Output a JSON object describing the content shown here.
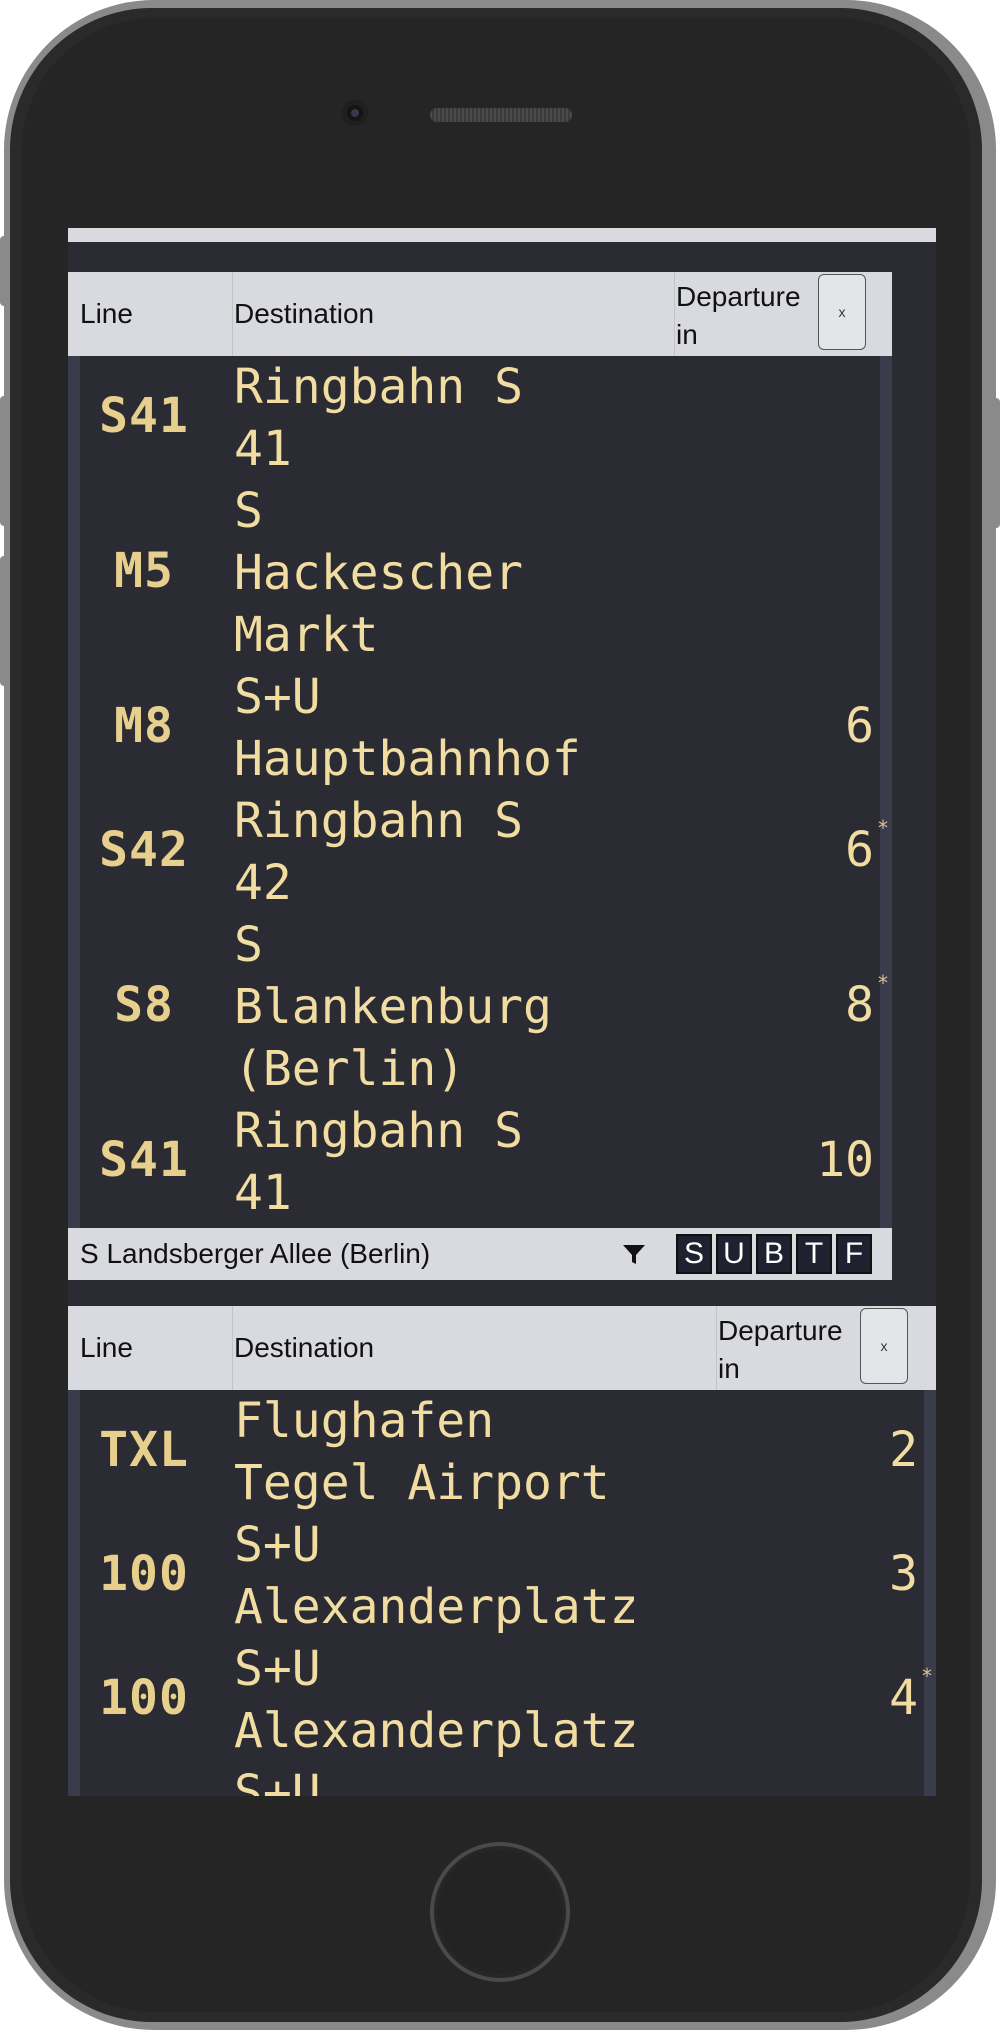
{
  "top_station": {
    "name": ""
  },
  "board1": {
    "headers": {
      "line": "Line",
      "destination": "Destination",
      "departure": "Departure\nin",
      "close": "x"
    },
    "rows": [
      {
        "line": "S41",
        "destination": "Ringbahn S\n41",
        "minutes": "",
        "delayed": false
      },
      {
        "line": "M5",
        "destination": "S\nHackescher\nMarkt",
        "minutes": "",
        "delayed": false
      },
      {
        "line": "M8",
        "destination": "S+U\nHauptbahnhof",
        "minutes": "6",
        "delayed": false
      },
      {
        "line": "S42",
        "destination": "Ringbahn S\n42",
        "minutes": "6",
        "delayed": true
      },
      {
        "line": "S8",
        "destination": "S\nBlankenburg\n(Berlin)",
        "minutes": "8",
        "delayed": true
      },
      {
        "line": "S41",
        "destination": "Ringbahn S\n41",
        "minutes": "10",
        "delayed": false
      }
    ]
  },
  "station2": {
    "name": "S Landsberger Allee (Berlin)",
    "filter_icon": "filter-icon",
    "modes": [
      "S",
      "U",
      "B",
      "T",
      "F"
    ]
  },
  "board2": {
    "headers": {
      "line": "Line",
      "destination": "Destination",
      "departure": "Departure\nin",
      "close": "x"
    },
    "rows": [
      {
        "line": "TXL",
        "destination": "Flughafen\nTegel Airport",
        "minutes": "2",
        "delayed": false
      },
      {
        "line": "100",
        "destination": "S+U\nAlexanderplatz",
        "minutes": "3",
        "delayed": false
      },
      {
        "line": "100",
        "destination": "S+U\nAlexanderplatz",
        "minutes": "4",
        "delayed": true
      },
      {
        "line": "",
        "destination": "S+U",
        "minutes": "",
        "delayed": false
      }
    ]
  },
  "delay_marker": "*",
  "colors": {
    "led": "#f1dca2",
    "board_bg": "#2b2b33",
    "header_bg": "#d9dadf",
    "mode_bg": "#1f2030"
  }
}
